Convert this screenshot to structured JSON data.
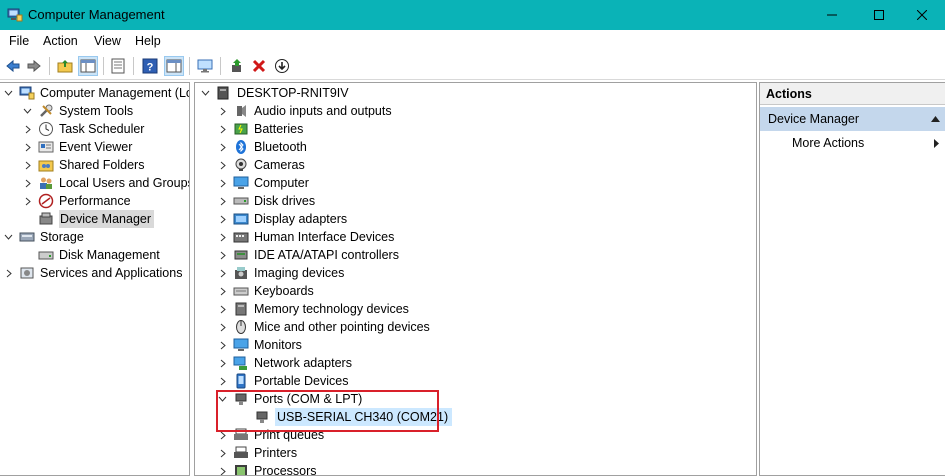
{
  "window": {
    "title": "Computer Management"
  },
  "menu": [
    "File",
    "Action",
    "View",
    "Help"
  ],
  "toolbar": {
    "icons": [
      "back-arrow-icon",
      "forward-arrow-icon",
      "up-folder-icon",
      "show-hide-tree-icon",
      "properties-icon",
      "help-icon",
      "show-hide-action-pane-icon",
      "monitor-icon",
      "update-driver-icon",
      "uninstall-icon",
      "download-icon"
    ]
  },
  "left_tree": {
    "root": "Computer Management (Local",
    "items": [
      {
        "label": "System Tools",
        "level": 1,
        "expanded": true,
        "icon": "tools-icon"
      },
      {
        "label": "Task Scheduler",
        "level": 2,
        "icon": "clock-icon"
      },
      {
        "label": "Event Viewer",
        "level": 2,
        "icon": "event-viewer-icon"
      },
      {
        "label": "Shared Folders",
        "level": 2,
        "icon": "shared-folder-icon"
      },
      {
        "label": "Local Users and Groups",
        "level": 2,
        "icon": "users-icon"
      },
      {
        "label": "Performance",
        "level": 2,
        "icon": "performance-icon"
      },
      {
        "label": "Device Manager",
        "level": 2,
        "icon": "device-manager-icon",
        "selected": true
      },
      {
        "label": "Storage",
        "level": 1,
        "expanded": true,
        "icon": "storage-icon"
      },
      {
        "label": "Disk Management",
        "level": 2,
        "icon": "disk-icon"
      },
      {
        "label": "Services and Applications",
        "level": 1,
        "icon": "services-icon"
      }
    ]
  },
  "device_tree": {
    "computer": "DESKTOP-RNIT9IV",
    "categories": [
      "Audio inputs and outputs",
      "Batteries",
      "Bluetooth",
      "Cameras",
      "Computer",
      "Disk drives",
      "Display adapters",
      "Human Interface Devices",
      "IDE ATA/ATAPI controllers",
      "Imaging devices",
      "Keyboards",
      "Memory technology devices",
      "Mice and other pointing devices",
      "Monitors",
      "Network adapters",
      "Portable Devices",
      "Ports (COM & LPT)",
      "Print queues",
      "Printers",
      "Processors"
    ],
    "ports_child": "USB-SERIAL CH340 (COM21)"
  },
  "actions": {
    "header": "Actions",
    "section": "Device Manager",
    "items": [
      "More Actions"
    ]
  },
  "colors": {
    "titlebar": "#0ab3b7",
    "highlight_box": "#d9202a",
    "selection": "#cce8ff",
    "action_section": "#c4d7ec"
  }
}
